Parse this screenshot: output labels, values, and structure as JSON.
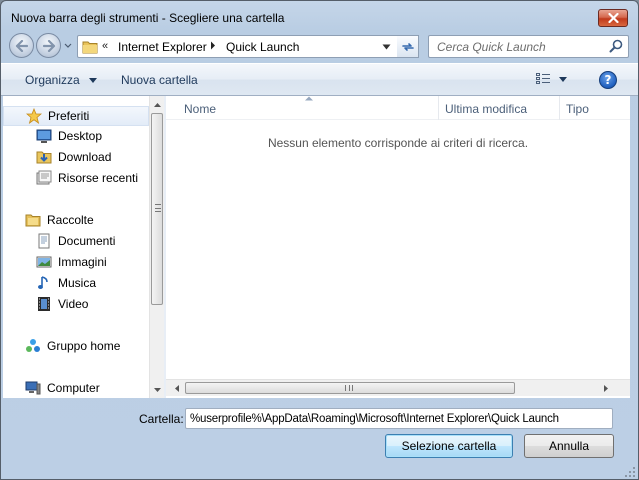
{
  "window": {
    "title": "Nuova barra degli strumenti - Scegliere una cartella"
  },
  "address_bar": {
    "overflow_marker": "«",
    "crumbs": [
      "Internet Explorer",
      "Quick Launch"
    ]
  },
  "search": {
    "placeholder": "Cerca Quick Launch"
  },
  "toolbar": {
    "organize_label": "Organizza",
    "new_folder_label": "Nuova cartella"
  },
  "navigation": {
    "items": [
      {
        "label": "Preferiti",
        "icon": "star-icon",
        "level": "top"
      },
      {
        "label": "Desktop",
        "icon": "desktop-icon",
        "level": "sub"
      },
      {
        "label": "Download",
        "icon": "download-folder-icon",
        "level": "sub"
      },
      {
        "label": "Risorse recenti",
        "icon": "recent-places-icon",
        "level": "sub"
      },
      {
        "label": "Raccolte",
        "icon": "libraries-icon",
        "level": "top"
      },
      {
        "label": "Documenti",
        "icon": "documents-icon",
        "level": "sub"
      },
      {
        "label": "Immagini",
        "icon": "pictures-icon",
        "level": "sub"
      },
      {
        "label": "Musica",
        "icon": "music-icon",
        "level": "sub"
      },
      {
        "label": "Video",
        "icon": "video-icon",
        "level": "sub"
      },
      {
        "label": "Gruppo home",
        "icon": "homegroup-icon",
        "level": "top"
      },
      {
        "label": "Computer",
        "icon": "computer-icon",
        "level": "top"
      }
    ]
  },
  "file_list": {
    "columns": [
      "Nome",
      "Ultima modifica",
      "Tipo"
    ],
    "empty_message": "Nessun elemento corrisponde ai criteri di ricerca."
  },
  "footer": {
    "folder_label": "Cartella:",
    "folder_value": "%userprofile%\\AppData\\Roaming\\Microsoft\\Internet Explorer\\Quick Launch",
    "select_button": "Selezione cartella",
    "cancel_button": "Annulla"
  },
  "colors": {
    "accent": "#1e395b",
    "window_frame": "#bccfe5",
    "close_button": "#c13a1c"
  }
}
